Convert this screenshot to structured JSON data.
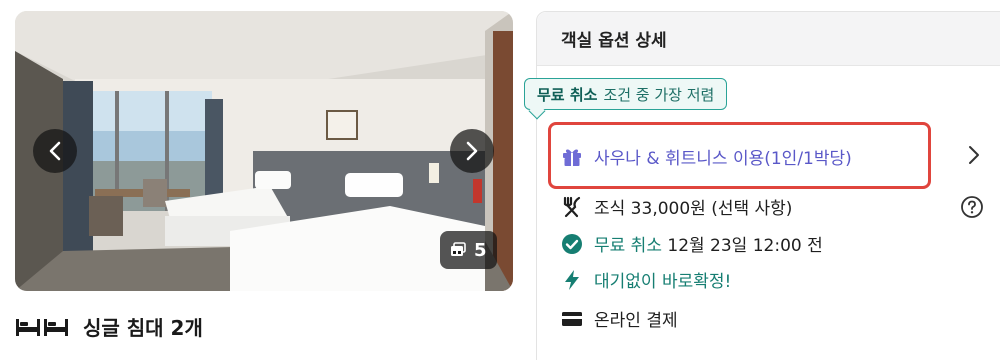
{
  "gallery": {
    "photo_count": "5",
    "prev_icon": "chevron-left-icon",
    "next_icon": "chevron-right-icon",
    "count_icon": "gallery-icon"
  },
  "room": {
    "bed_icon": "twin-bed-icon",
    "bed_text": "싱글 침대 2개"
  },
  "options": {
    "header": "객실 옵션 상세",
    "badge": {
      "strong": "무료 취소",
      "rest": "조건 중 가장 저렴"
    },
    "items": [
      {
        "icon": "gift-icon",
        "text": "사우나 & 휘트니스 이용(1인/1박당)"
      },
      {
        "icon": "fork-knife-icon",
        "text": "조식 33,000원 (선택 사항)"
      },
      {
        "icon": "check-circle-icon",
        "text_green": "무료 취소",
        "text_dark": "12월 23일 12:00 전"
      },
      {
        "icon": "lightning-icon",
        "text": "대기없이 바로확정!"
      },
      {
        "icon": "card-icon",
        "text": "온라인 결제"
      }
    ]
  },
  "colors": {
    "accent_purple": "#5a58c8",
    "accent_green": "#167e72",
    "highlight_red": "#e0453d"
  }
}
